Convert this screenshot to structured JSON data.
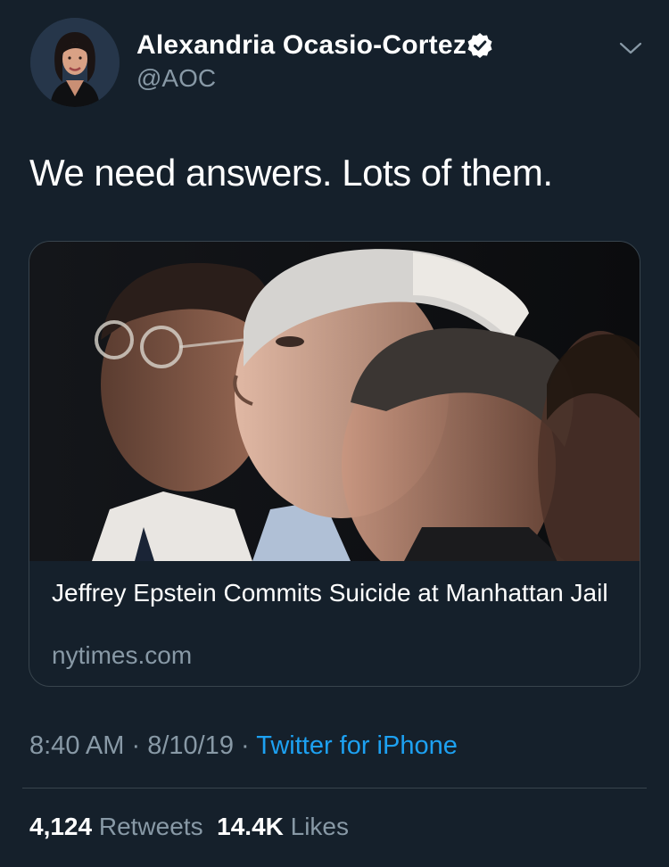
{
  "author": {
    "name": "Alexandria Ocasio-Cortez",
    "handle": "@AOC",
    "verified_icon": "verified-badge-icon",
    "avatar_icon": "profile-photo"
  },
  "menu_icon": "chevron-down-icon",
  "tweet": {
    "text": "We need answers. Lots of them."
  },
  "link_card": {
    "image": "news-photo",
    "title": "Jeffrey Epstein Commits Suicide at Manhattan Jail",
    "domain": "nytimes.com"
  },
  "meta": {
    "time": "8:40 AM",
    "separator1": " · ",
    "date": "8/10/19",
    "separator2": " · ",
    "source": "Twitter for iPhone"
  },
  "stats": {
    "retweets_count": "4,124",
    "retweets_label": "Retweets",
    "likes_count": "14.4K",
    "likes_label": "Likes"
  },
  "colors": {
    "background": "#15202b",
    "secondary_text": "#8899a6",
    "accent": "#1da1f2",
    "border": "#38444d"
  }
}
